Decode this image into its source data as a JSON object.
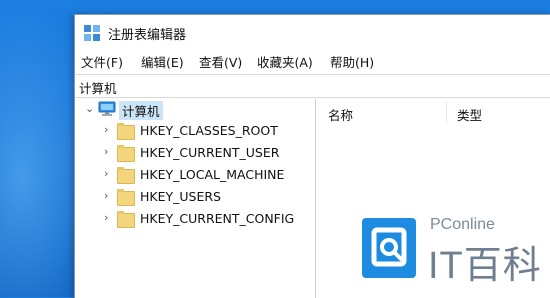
{
  "window": {
    "title": "注册表编辑器"
  },
  "menu": [
    {
      "label": "文件(F)"
    },
    {
      "label": "编辑(E)"
    },
    {
      "label": "查看(V)"
    },
    {
      "label": "收藏夹(A)"
    },
    {
      "label": "帮助(H)"
    }
  ],
  "address": {
    "path": "计算机"
  },
  "tree": {
    "root": {
      "label": "计算机",
      "icon": "computer-icon",
      "expanded": true,
      "selected": true
    },
    "children": [
      {
        "label": "HKEY_CLASSES_ROOT",
        "icon": "folder-icon"
      },
      {
        "label": "HKEY_CURRENT_USER",
        "icon": "folder-icon"
      },
      {
        "label": "HKEY_LOCAL_MACHINE",
        "icon": "folder-icon"
      },
      {
        "label": "HKEY_USERS",
        "icon": "folder-icon"
      },
      {
        "label": "HKEY_CURRENT_CONFIG",
        "icon": "folder-icon"
      }
    ]
  },
  "list": {
    "columns": [
      {
        "label": "名称"
      },
      {
        "label": "类型"
      }
    ]
  },
  "watermark": {
    "small": "PConline",
    "big": "IT百科"
  },
  "colors": {
    "desktop": "#1573d6",
    "selection": "#cce4f7",
    "folder": "#f3d57c",
    "watermark_blue": "#1c8be0"
  }
}
